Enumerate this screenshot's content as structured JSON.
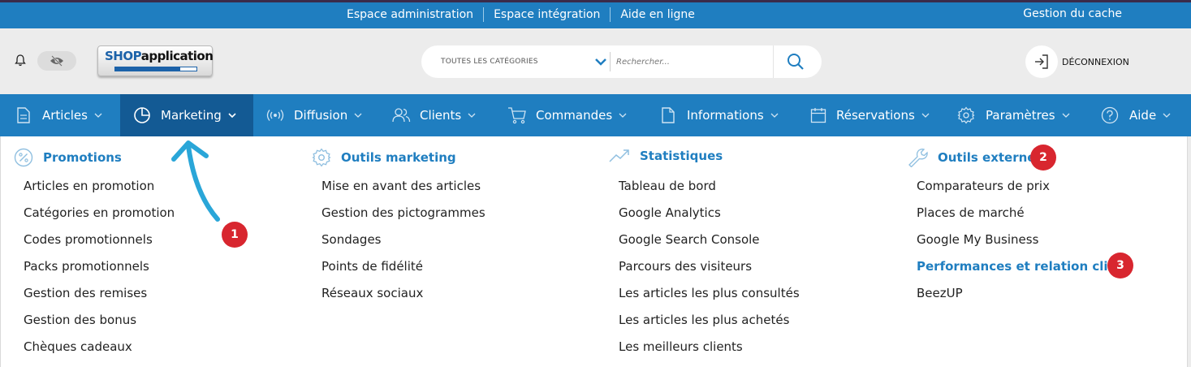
{
  "topbar": {
    "links": [
      "Espace administration",
      "Espace intégration",
      "Aide en ligne"
    ],
    "cache": "Gestion du cache"
  },
  "header": {
    "logo_shop": "SHOP",
    "logo_app": "application",
    "search_category": "TOUTES LES CATÉGORIES",
    "search_placeholder": "Rechercher...",
    "logout": "DÉCONNEXION"
  },
  "nav": [
    {
      "label": "Articles",
      "icon": "document-icon"
    },
    {
      "label": "Marketing",
      "icon": "pie-chart-icon"
    },
    {
      "label": "Diffusion",
      "icon": "broadcast-icon"
    },
    {
      "label": "Clients",
      "icon": "users-icon"
    },
    {
      "label": "Commandes",
      "icon": "cart-icon"
    },
    {
      "label": "Informations",
      "icon": "file-icon"
    },
    {
      "label": "Réservations",
      "icon": "calendar-icon"
    },
    {
      "label": "Paramètres",
      "icon": "gear-icon"
    },
    {
      "label": "Aide",
      "icon": "help-icon"
    }
  ],
  "menu": {
    "promotions": {
      "title": "Promotions",
      "items": [
        "Articles en promotion",
        "Catégories en promotion",
        "Codes promotionnels",
        "Packs promotionnels",
        "Gestion des remises",
        "Gestion des bonus",
        "Chèques cadeaux"
      ]
    },
    "outils_marketing": {
      "title": "Outils marketing",
      "items": [
        "Mise en avant des articles",
        "Gestion des pictogrammes",
        "Sondages",
        "Points de fidélité",
        "Réseaux sociaux"
      ]
    },
    "statistiques": {
      "title": "Statistiques",
      "items": [
        "Tableau de bord",
        "Google Analytics",
        "Google Search Console",
        "Parcours des visiteurs",
        "Les articles les plus consultés",
        "Les articles les plus achetés",
        "Les meilleurs clients"
      ]
    },
    "outils_externes": {
      "title": "Outils externes",
      "items": [
        "Comparateurs de prix",
        "Places de marché",
        "Google My Business",
        "Performances et relation client",
        "BeezUP"
      ]
    }
  },
  "badges": [
    "1",
    "2",
    "3"
  ],
  "colors": {
    "primary": "#1f7ec0",
    "active": "#135a94",
    "badge": "#d8262f",
    "arrow": "#2aa6d8"
  }
}
